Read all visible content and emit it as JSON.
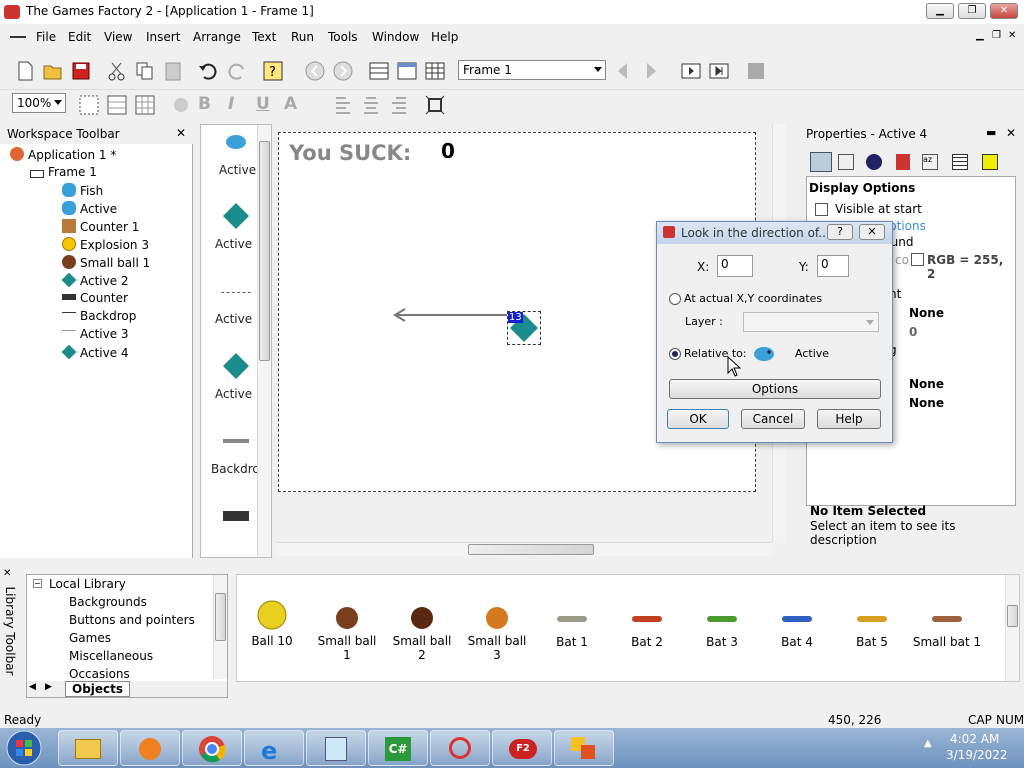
{
  "window": {
    "title": "The Games Factory 2 - [Application 1 - Frame 1]"
  },
  "menu": [
    "File",
    "Edit",
    "View",
    "Insert",
    "Arrange",
    "Text",
    "Run",
    "Tools",
    "Window",
    "Help"
  ],
  "toolbar": {
    "frame_select": "Frame 1",
    "zoom": "100%"
  },
  "workspace": {
    "title": "Workspace Toolbar",
    "application": "Application 1 *",
    "frame": "Frame 1",
    "objects": [
      "Fish",
      "Active",
      "Counter 1",
      "Explosion 3",
      "Small ball 1",
      "Active 2",
      "Counter",
      "Backdrop",
      "Active 3",
      "Active 4"
    ]
  },
  "object_bar": [
    "Active",
    "Active",
    "Active",
    "Active",
    "Backdro"
  ],
  "canvas": {
    "score_label": "You SUCK:",
    "score_value": "0",
    "selected_badge": "13"
  },
  "properties": {
    "title": "Properties - Active 4",
    "section": "Display Options",
    "visible_at_start": "Visible at start",
    "options_partial": "ptions",
    "ground_partial": "ground",
    "rgb_partial": "RGB = 255, 2",
    "nt_partial": "nt",
    "g_partial": "g",
    "vals": [
      "None",
      "0",
      "None",
      "None"
    ],
    "co_partial": "co",
    "no_item_title": "No Item Selected",
    "no_item_desc": "Select an item to see its description"
  },
  "dialog": {
    "title": "Look in the direction of...",
    "help_glyph": "?",
    "x_label": "X:",
    "x_value": "0",
    "y_label": "Y:",
    "y_value": "0",
    "radio_actual": "At actual X,Y coordinates",
    "layer_label": "Layer :",
    "radio_relative": "Relative to:",
    "relative_object": "Active",
    "options_btn": "Options",
    "ok_btn": "OK",
    "cancel_btn": "Cancel",
    "help_btn": "Help"
  },
  "library": {
    "side_label": "Library Toolbar",
    "tree": [
      "Local Library",
      "Backgrounds",
      "Buttons and pointers",
      "Games",
      "Miscellaneous",
      "Occasions"
    ],
    "tab": "Objects",
    "items": [
      "Ball 10",
      "Small ball 1",
      "Small ball 2",
      "Small ball 3",
      "Bat 1",
      "Bat 2",
      "Bat 3",
      "Bat 4",
      "Bat 5",
      "Small bat 1"
    ]
  },
  "status": {
    "left": "Ready",
    "coords": "450, 226",
    "caps": "CAP",
    "num": "NUM"
  },
  "taskbar": {
    "time": "4:02 AM",
    "date": "3/19/2022"
  },
  "colors": {
    "teal": "#1a8c8c",
    "fish": "#3aa0d8",
    "taskbar": "#7a9cc6"
  }
}
